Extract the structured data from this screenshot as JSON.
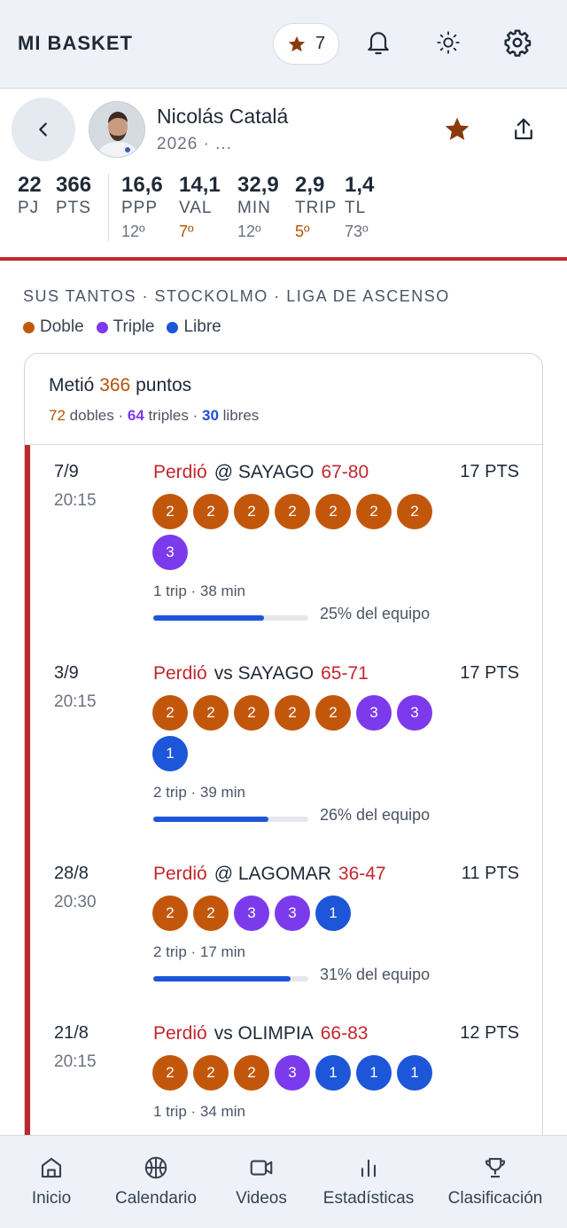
{
  "app": {
    "title": "MI BASKET",
    "favorites_count": "7"
  },
  "colors": {
    "accent": "#c1272d",
    "doble": "#c2570c",
    "triple": "#7c3aed",
    "libre": "#1d56d8"
  },
  "player": {
    "name": "Nicolás Catalá",
    "subtitle": "2026 · ...",
    "stats": [
      {
        "value": "22",
        "label": "PJ"
      },
      {
        "value": "366",
        "label": "PTS"
      },
      {
        "value": "16,6",
        "label": "PPP",
        "rank": "12º"
      },
      {
        "value": "14,1",
        "label": "VAL",
        "rank": "7º"
      },
      {
        "value": "32,9",
        "label": "MIN",
        "rank": "12º"
      },
      {
        "value": "2,9",
        "label": "TRIP",
        "rank": "5º"
      },
      {
        "value": "1,4",
        "label": "TL",
        "rank": "73º"
      }
    ]
  },
  "section": {
    "title": "SUS TANTOS · STOCKOLMO · LIGA DE ASCENSO",
    "legend": [
      "Doble",
      "Triple",
      "Libre"
    ]
  },
  "summary": {
    "prefix": "Metió",
    "points": "366",
    "suffix": "puntos",
    "dobles_n": "72",
    "dobles_label": "dobles",
    "triples_n": "64",
    "triples_label": "triples",
    "libres_n": "30",
    "libres_label": "libres"
  },
  "games": [
    {
      "date": "7/9",
      "time": "20:15",
      "result": "Perdió",
      "opponent": "@ SAYAGO",
      "score": "67-80",
      "pts": "17 PTS",
      "shots": [
        2,
        2,
        2,
        2,
        2,
        2,
        2,
        3
      ],
      "meta": "1 trip · 38 min",
      "team_share": 0.25,
      "team_share_label": "25% del equipo"
    },
    {
      "date": "3/9",
      "time": "20:15",
      "result": "Perdió",
      "opponent": "vs SAYAGO",
      "score": "65-71",
      "pts": "17 PTS",
      "shots": [
        2,
        2,
        2,
        2,
        2,
        3,
        3,
        1
      ],
      "meta": "2 trip · 39 min",
      "team_share": 0.26,
      "team_share_label": "26% del equipo"
    },
    {
      "date": "28/8",
      "time": "20:30",
      "result": "Perdió",
      "opponent": "@ LAGOMAR",
      "score": "36-47",
      "pts": "11 PTS",
      "shots": [
        2,
        2,
        3,
        3,
        1
      ],
      "meta": "2 trip · 17 min",
      "team_share": 0.31,
      "team_share_label": "31% del equipo"
    },
    {
      "date": "21/8",
      "time": "20:15",
      "result": "Perdió",
      "opponent": "vs OLIMPIA",
      "score": "66-83",
      "pts": "12 PTS",
      "shots": [
        2,
        2,
        2,
        3,
        1,
        1,
        1
      ],
      "meta": "1 trip · 34 min",
      "team_share": null,
      "team_share_label": ""
    }
  ],
  "nav": [
    {
      "label": "Inicio",
      "icon": "home-icon"
    },
    {
      "label": "Calendario",
      "icon": "basketball-icon"
    },
    {
      "label": "Videos",
      "icon": "video-icon"
    },
    {
      "label": "Estadísticas",
      "icon": "bar-chart-icon"
    },
    {
      "label": "Clasificación",
      "icon": "trophy-icon"
    }
  ]
}
